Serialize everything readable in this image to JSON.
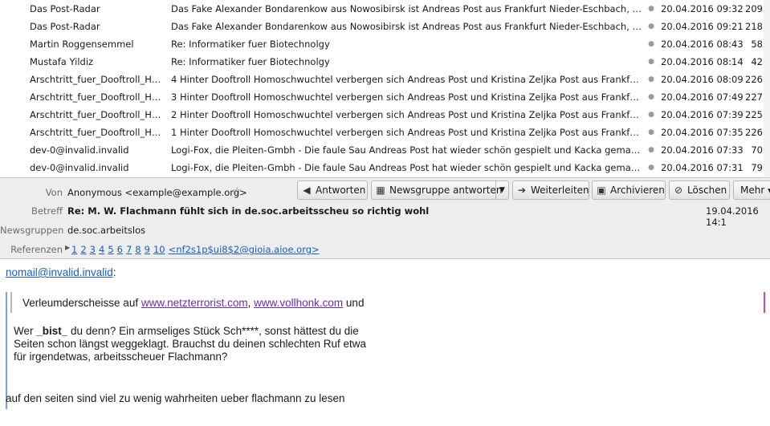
{
  "message_list": {
    "rows": [
      {
        "from": "Das Post-Radar",
        "subject": "Das Fake Alexander Bondarenkow aus Nowosibirsk ist Andreas Post aus Frankfurt Nieder-Eschbach, hinter der Maske",
        "date": "20.04.2016 09:32",
        "size": "209"
      },
      {
        "from": "Das Post-Radar",
        "subject": "Das Fake Alexander Bondarenkow aus Nowosibirsk ist Andreas Post aus Frankfurt Nieder-Eschbach, hinter der Maske",
        "date": "20.04.2016 09:21",
        "size": "218"
      },
      {
        "from": "Martin Roggensemmel",
        "subject": "Re: Informatiker fuer Biotechnolgy",
        "date": "20.04.2016 08:43",
        "size": "58"
      },
      {
        "from": "Mustafa Yildiz",
        "subject": "Re: Informatiker fuer Biotechnolgy",
        "date": "20.04.2016 08:14",
        "size": "42"
      },
      {
        "from": "Arschtritt_fuer_Dooftroll_Homoschwuchtel",
        "subject": "4 Hinter Dooftroll Homoschwuchtel verbergen sich Andreas Post und Kristina Zeljka Post aus Frankfurt Nieder-Eschbach",
        "date": "20.04.2016 08:09",
        "size": "226"
      },
      {
        "from": "Arschtritt_fuer_Dooftroll_Homoschwuchtel",
        "subject": "3 Hinter Dooftroll Homoschwuchtel verbergen sich Andreas Post und Kristina Zeljka Post aus Frankfurt Nieder-Eschbach",
        "date": "20.04.2016 07:49",
        "size": "227"
      },
      {
        "from": "Arschtritt_fuer_Dooftroll_Homoschwuchtel",
        "subject": "2 Hinter Dooftroll Homoschwuchtel verbergen sich Andreas Post und Kristina Zeljka Post aus Frankfurt Nieder-Eschbach",
        "date": "20.04.2016 07:39",
        "size": "225"
      },
      {
        "from": "Arschtritt_fuer_Dooftroll_Homoschwuchtel",
        "subject": "1 Hinter Dooftroll Homoschwuchtel verbergen sich Andreas Post und Kristina Zeljka Post aus Frankfurt Nieder-Eschbach",
        "date": "20.04.2016 07:35",
        "size": "226"
      },
      {
        "from": "dev-0@invalid.invalid",
        "subject": "Logi-Fox, die Pleiten-Gmbh - Die faule Sau Andreas Post hat wieder schön gespielt und Kacka gemacht in de.soc.arbeitsscheu",
        "date": "20.04.2016 07:33",
        "size": "70"
      },
      {
        "from": "dev-0@invalid.invalid",
        "subject": "Logi-Fox, die Pleiten-Gmbh - Die faule Sau Andreas Post hat wieder schön gespielt und Kacka gemacht in de.soc.arbeitsscheu",
        "date": "20.04.2016 07:31",
        "size": "79"
      }
    ]
  },
  "header": {
    "from_label": "Von",
    "from_value": "Anonymous <example@example.org>",
    "subject_label": "Betreff",
    "subject_value": "Re: M. W. Flachmann fühlt sich in de.soc.arbeitsscheu so richtig wohl",
    "date_value": "19.04.2016 14:1",
    "newsgroups_label": "Newsgruppen",
    "newsgroups_value": "de.soc.arbeitslos",
    "references_label": "Referenzen",
    "references": [
      "1",
      "2",
      "3",
      "4",
      "5",
      "6",
      "7",
      "8",
      "9",
      "10"
    ],
    "reference_msgid": "<nf2s1p$ui8$2@gioia.aioe.org>",
    "star_icon": "star-icon"
  },
  "toolbar": {
    "reply": "Antworten",
    "reply_newsgroup": "Newsgruppe antworten",
    "forward": "Weiterleiten",
    "archive": "Archivieren",
    "delete": "Löschen",
    "more": "Mehr"
  },
  "message_body": {
    "attribution_email": "nomail@invalid.invalid",
    "attribution_suffix": ":",
    "quote2_prefix": "Verleumderscheisse auf ",
    "quote2_link1": "www.netzterrorist.com",
    "quote2_sep": ", ",
    "quote2_link2": "www.vollhonk.com",
    "quote2_suffix": " und",
    "quote1_line1_a": "Wer ",
    "quote1_line1_b": "_bist_",
    "quote1_line1_c": " du denn? Ein armseliges Stück Sch****, sonst hättest du die",
    "quote1_line2": "Seiten schon längst weggeklagt. Brauchst du deinen schlechten Ruf etwa",
    "quote1_line3": "für irgendetwas, arbeitsscheuer Flachmann?",
    "reply_text": "auf den seiten sind viel zu wenig wahrheiten ueber flachmann zu lesen"
  },
  "colors": {
    "link": "#1a5fb4",
    "visited_link": "#6b2ea0",
    "header_bg": "#ededed",
    "quote_bar_outer": "#7aa3cf",
    "quote_bar_right": "#c44db0"
  }
}
